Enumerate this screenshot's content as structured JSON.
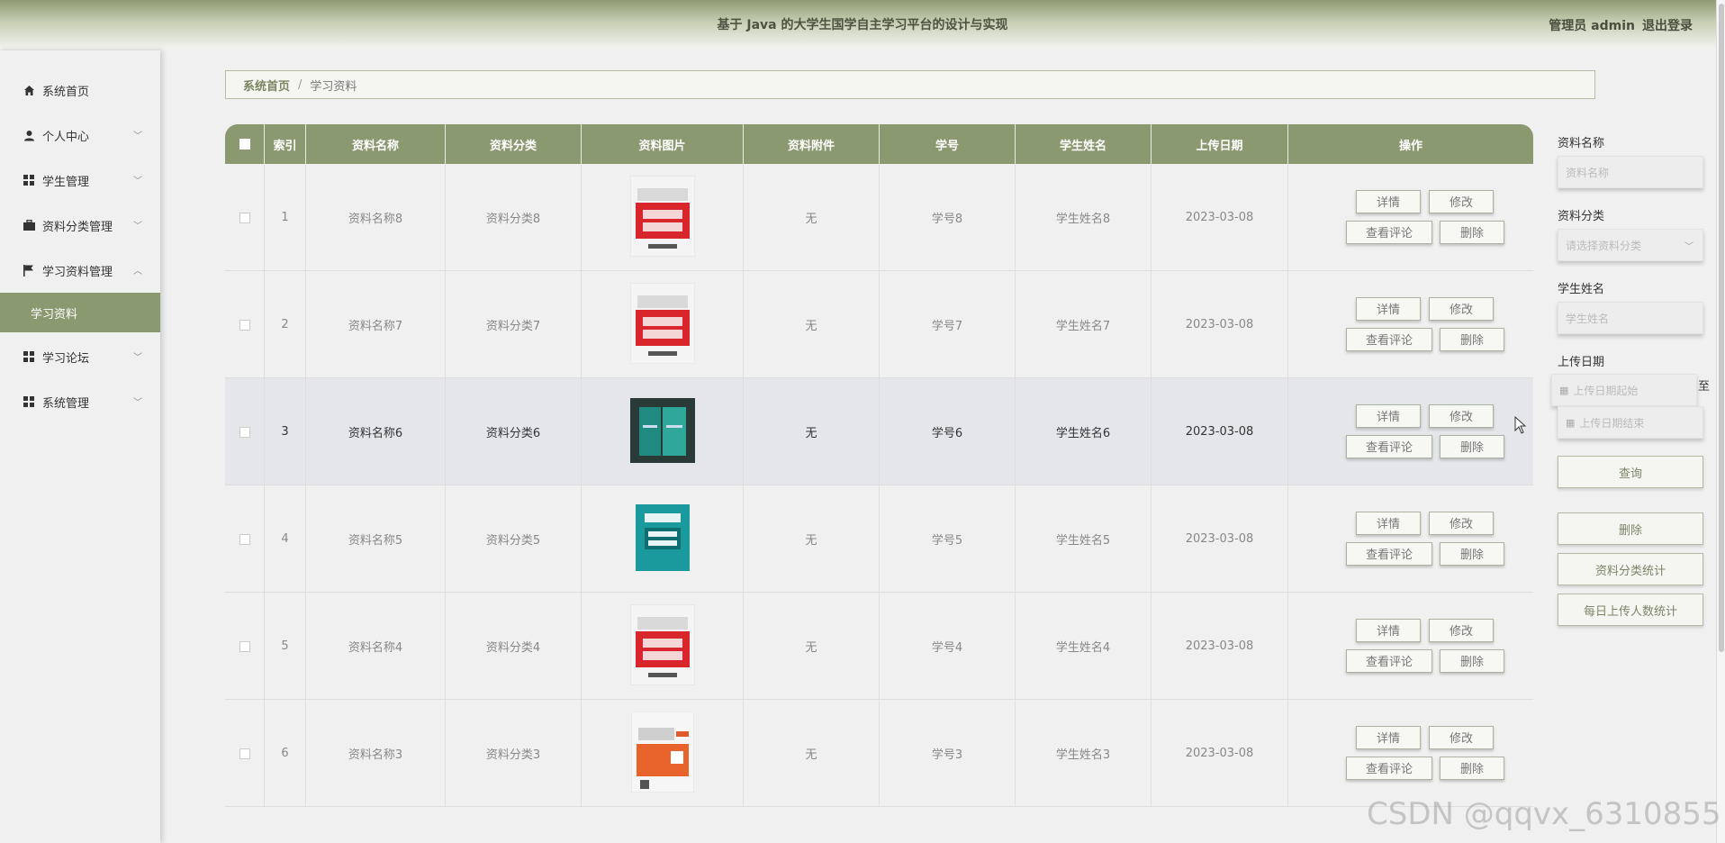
{
  "header": {
    "title": "基于 Java 的大学生国学自主学习平台的设计与实现",
    "user": "管理员 admin",
    "logout": "退出登录"
  },
  "sidebar": {
    "items": [
      {
        "label": "系统首页",
        "icon": "home-icon"
      },
      {
        "label": "个人中心",
        "icon": "user-icon"
      },
      {
        "label": "学生管理",
        "icon": "grid-icon"
      },
      {
        "label": "资料分类管理",
        "icon": "briefcase-icon"
      },
      {
        "label": "学习资料管理",
        "icon": "flag-icon"
      },
      {
        "label": "学习资料",
        "icon": ""
      },
      {
        "label": "学习论坛",
        "icon": "grid-icon"
      },
      {
        "label": "系统管理",
        "icon": "grid-icon"
      }
    ]
  },
  "breadcrumb": {
    "home": "系统首页",
    "sep": "/",
    "current": "学习资料"
  },
  "table": {
    "columns": [
      "索引",
      "资料名称",
      "资料分类",
      "资料图片",
      "资料附件",
      "学号",
      "学生姓名",
      "上传日期",
      "操作"
    ],
    "rows": [
      {
        "index": "1",
        "name": "资料名称8",
        "category": "资料分类8",
        "attachment": "无",
        "student_id": "学号8",
        "student_name": "学生姓名8",
        "date": "2023-03-08"
      },
      {
        "index": "2",
        "name": "资料名称7",
        "category": "资料分类7",
        "attachment": "无",
        "student_id": "学号7",
        "student_name": "学生姓名7",
        "date": "2023-03-08"
      },
      {
        "index": "3",
        "name": "资料名称6",
        "category": "资料分类6",
        "attachment": "无",
        "student_id": "学号6",
        "student_name": "学生姓名6",
        "date": "2023-03-08"
      },
      {
        "index": "4",
        "name": "资料名称5",
        "category": "资料分类5",
        "attachment": "无",
        "student_id": "学号5",
        "student_name": "学生姓名5",
        "date": "2023-03-08"
      },
      {
        "index": "5",
        "name": "资料名称4",
        "category": "资料分类4",
        "attachment": "无",
        "student_id": "学号4",
        "student_name": "学生姓名4",
        "date": "2023-03-08"
      },
      {
        "index": "6",
        "name": "资料名称3",
        "category": "资料分类3",
        "attachment": "无",
        "student_id": "学号3",
        "student_name": "学生姓名3",
        "date": "2023-03-08"
      }
    ],
    "actions": {
      "detail": "详情",
      "edit": "修改",
      "comments": "查看评论",
      "delete": "删除"
    }
  },
  "filters": {
    "name_label": "资料名称",
    "name_placeholder": "资料名称",
    "category_label": "资料分类",
    "category_placeholder": "请选择资料分类",
    "student_label": "学生姓名",
    "student_placeholder": "学生姓名",
    "date_label": "上传日期",
    "date_start": "上传日期起始",
    "date_to": "至",
    "date_end": "上传日期结束",
    "query": "查询",
    "delete": "删除",
    "stat_category": "资料分类统计",
    "stat_daily": "每日上传人数统计"
  },
  "watermark": "CSDN @qqvx_6310855",
  "colors": {
    "accent": "#8b9971",
    "header_text": "#4d5340"
  }
}
